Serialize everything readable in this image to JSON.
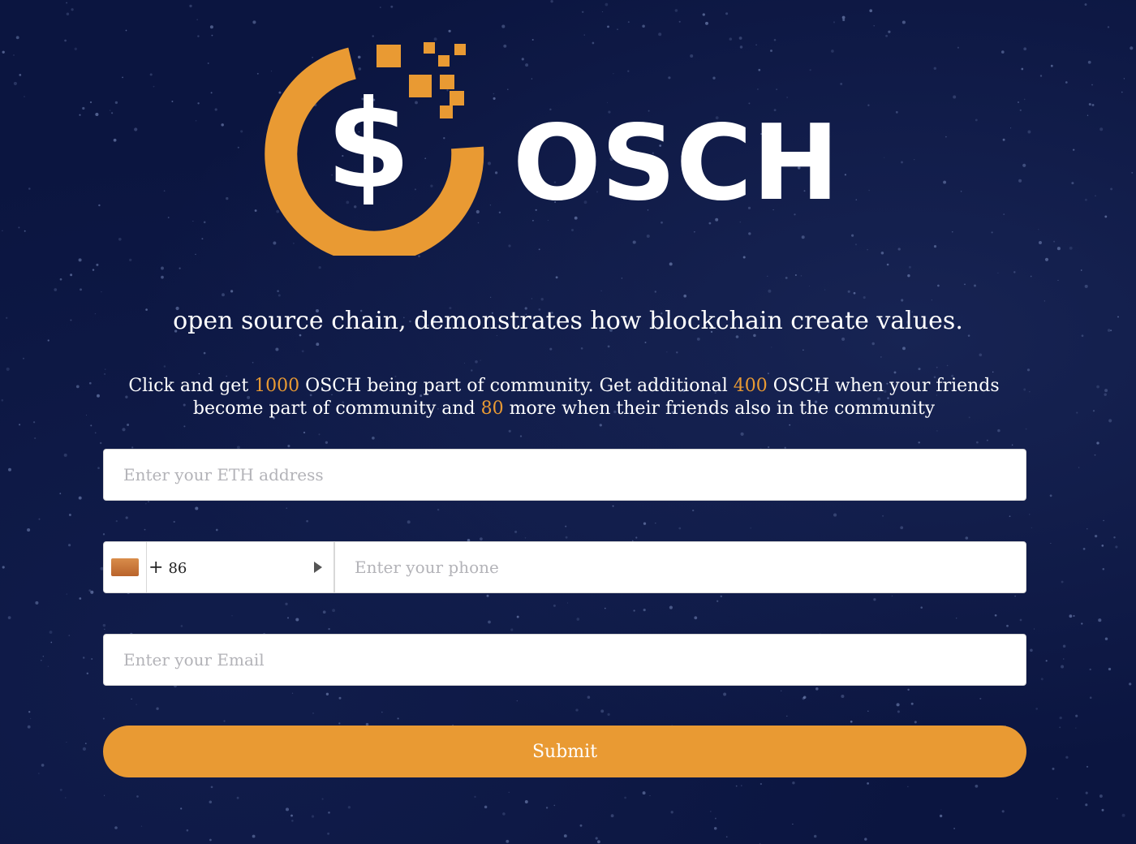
{
  "brand": {
    "name": "OSCH",
    "logo_symbol": "$",
    "colors": {
      "accent": "#e99a33",
      "background": "#0b1540",
      "text": "#ffffff"
    }
  },
  "tagline": "open source chain, demonstrates how blockchain create values.",
  "promo": {
    "part1": "Click and get ",
    "amount1": "1000",
    "part2": " OSCH being part of community. Get additional ",
    "amount2": "400",
    "part3": " OSCH when your friends become part of community and ",
    "amount3": "80",
    "part4": " more when their friends also in the community"
  },
  "form": {
    "eth_placeholder": "Enter your ETH address",
    "country_plus": "+",
    "country_code": "86",
    "phone_placeholder": "Enter your phone",
    "email_placeholder": "Enter your Email",
    "submit_label": "Submit"
  },
  "icons": {
    "logo": "coin-dollar-logo-icon",
    "flag": "china-flag-icon",
    "dropdown": "caret-right-icon"
  }
}
